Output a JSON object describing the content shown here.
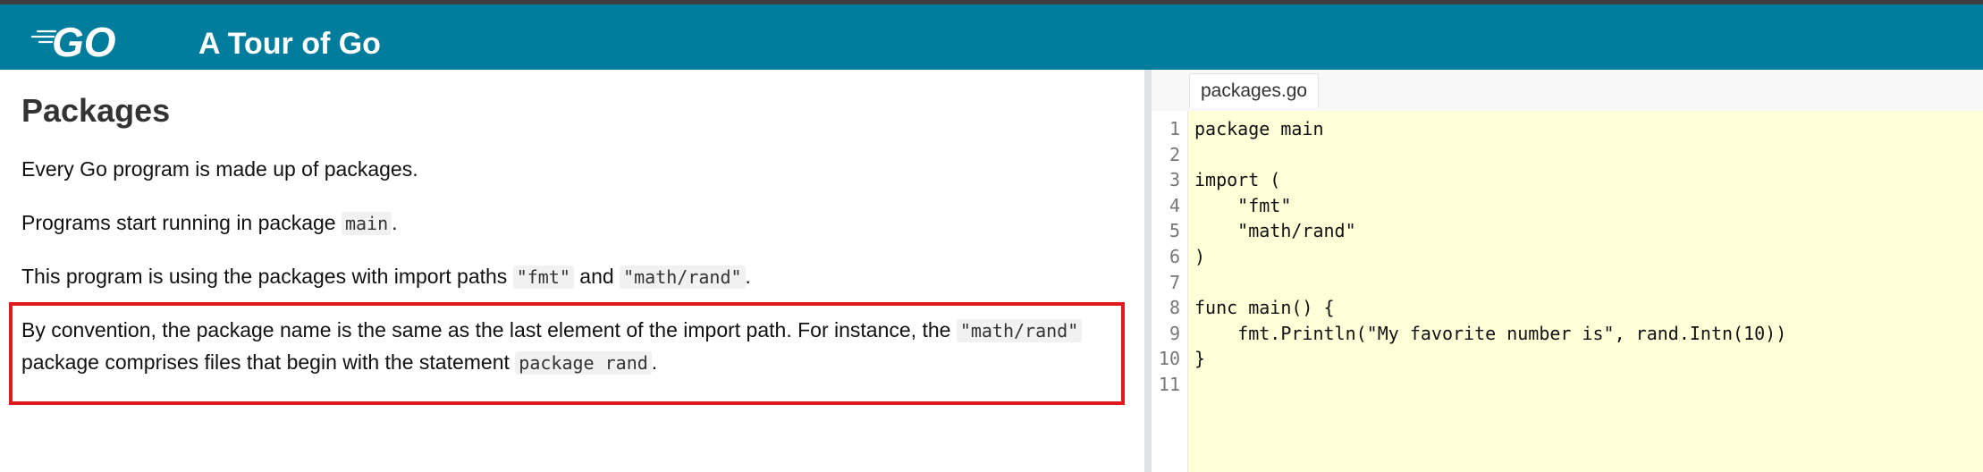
{
  "header": {
    "logo_text": "GO",
    "title": "A Tour of Go",
    "brand_color": "#007d9c"
  },
  "lesson": {
    "title": "Packages",
    "p1": "Every Go program is made up of packages.",
    "p2": {
      "before": "Programs start running in package ",
      "code": "main",
      "after": "."
    },
    "p3": {
      "before": "This program is using the packages with import paths ",
      "code1": "\"fmt\"",
      "middle": " and ",
      "code2": "\"math/rand\"",
      "after": "."
    },
    "p4": {
      "before": "By convention, the package name is the same as the last element of the import path. For instance, the ",
      "code1": "\"math/rand\"",
      "middle": " package comprises files that begin with the statement ",
      "code2": "package rand",
      "after": "."
    },
    "highlight_color": "#e01a1f"
  },
  "editor": {
    "tab_label": "packages.go",
    "lines": [
      {
        "num": "1",
        "text": "package main"
      },
      {
        "num": "2",
        "text": ""
      },
      {
        "num": "3",
        "text": "import ("
      },
      {
        "num": "4",
        "text": "    \"fmt\""
      },
      {
        "num": "5",
        "text": "    \"math/rand\""
      },
      {
        "num": "6",
        "text": ")"
      },
      {
        "num": "7",
        "text": ""
      },
      {
        "num": "8",
        "text": "func main() {"
      },
      {
        "num": "9",
        "text": "    fmt.Println(\"My favorite number is\", rand.Intn(10))"
      },
      {
        "num": "10",
        "text": "}"
      },
      {
        "num": "11",
        "text": ""
      }
    ]
  }
}
